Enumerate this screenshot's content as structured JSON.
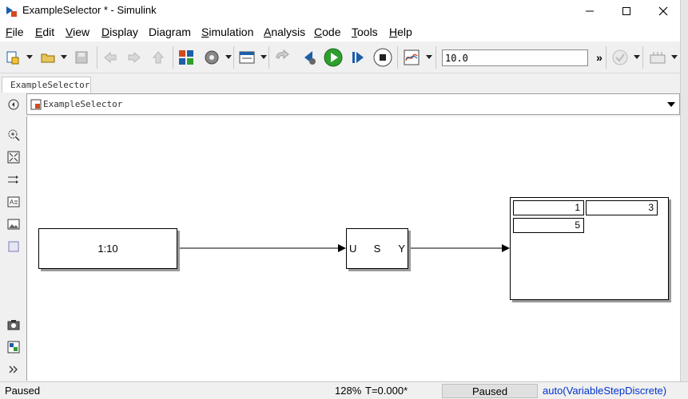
{
  "window": {
    "title": "ExampleSelector * - Simulink",
    "minimize_icon": "minimize-icon",
    "maximize_icon": "maximize-icon",
    "close_icon": "close-icon"
  },
  "menu": [
    {
      "label": "File",
      "key": "F"
    },
    {
      "label": "Edit",
      "key": "E"
    },
    {
      "label": "View",
      "key": "V"
    },
    {
      "label": "Display",
      "key": "D"
    },
    {
      "label": "Diagram",
      "key": ""
    },
    {
      "label": "Simulation",
      "key": "S"
    },
    {
      "label": "Analysis",
      "key": "A"
    },
    {
      "label": "Code",
      "key": "C"
    },
    {
      "label": "Tools",
      "key": "T"
    },
    {
      "label": "Help",
      "key": "H"
    }
  ],
  "toolbar": {
    "stop_time": "10.0",
    "more": "»"
  },
  "tab": {
    "label": "ExampleSelector"
  },
  "address": {
    "path": "ExampleSelector"
  },
  "model": {
    "constant": {
      "value": "1:10"
    },
    "selector": {
      "in_port": "U",
      "name": "S",
      "out_port": "Y"
    },
    "display": {
      "cells": [
        "1",
        "3",
        "5"
      ]
    }
  },
  "status": {
    "state": "Paused",
    "zoom": "128%",
    "time": "T=0.000*",
    "run_state": "Paused",
    "solver": "auto(VariableStepDiscrete)"
  },
  "colors": {
    "run_green": "#2e9f2e",
    "link_blue": "#0033cc"
  }
}
